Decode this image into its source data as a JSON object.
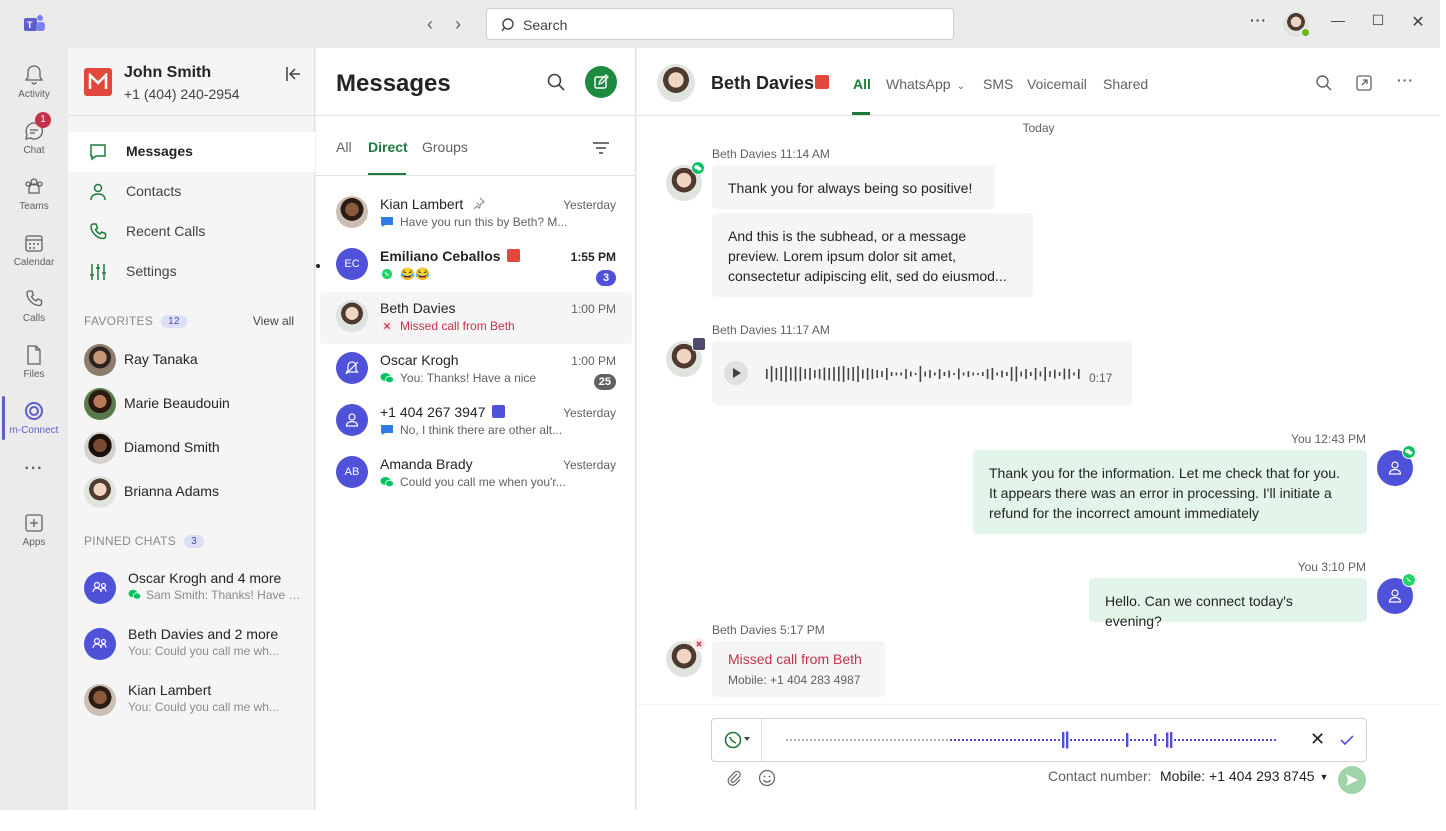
{
  "search": {
    "placeholder": "Search"
  },
  "rail": [
    {
      "label": "Activity"
    },
    {
      "label": "Chat",
      "badge": "1"
    },
    {
      "label": "Teams"
    },
    {
      "label": "Calendar"
    },
    {
      "label": "Calls"
    },
    {
      "label": "Files"
    },
    {
      "label": "m-Connect"
    },
    {
      "label": "Apps"
    }
  ],
  "user": {
    "name": "John Smith",
    "number": "+1 (404) 240-2954"
  },
  "nav": {
    "items": [
      {
        "label": "Messages"
      },
      {
        "label": "Contacts"
      },
      {
        "label": "Recent Calls"
      },
      {
        "label": "Settings"
      }
    ],
    "favorites_label": "FAVORITES",
    "favorites_count": "12",
    "view_all": "View all",
    "favorites": [
      "Ray Tanaka",
      "Marie Beaudouin",
      "Diamond Smith",
      "Brianna Adams"
    ],
    "pinned_label": "PINNED CHATS",
    "pinned_count": "3",
    "pinned": [
      {
        "title": "Oscar Krogh and 4 more",
        "preview": "Sam Smith: Thanks! Have a..."
      },
      {
        "title": "Beth Davies and 2 more",
        "preview": "You: Could you call me wh..."
      },
      {
        "title": "Kian Lambert",
        "preview": "You: Could you call me wh..."
      }
    ]
  },
  "messages": {
    "title": "Messages",
    "tabs": [
      "All",
      "Direct",
      "Groups"
    ],
    "list": [
      {
        "name": "Kian Lambert",
        "preview": "Have you run this by Beth? M...",
        "time": "Yesterday"
      },
      {
        "name": "Emiliano Ceballos",
        "initials": "EC",
        "preview": "😂😂",
        "time": "1:55 PM",
        "badge": "3"
      },
      {
        "name": "Beth Davies",
        "preview": "Missed call from Beth",
        "time": "1:00 PM"
      },
      {
        "name": "Oscar Krogh",
        "preview": "You: Thanks! Have a nice",
        "time": "1:00 PM",
        "badge": "25"
      },
      {
        "name": "+1 404 267 3947",
        "preview": "No, I think there are other alt...",
        "time": "Yesterday"
      },
      {
        "name": "Amanda Brady",
        "initials": "AB",
        "preview": "Could you call me when you'r...",
        "time": "Yesterday"
      }
    ]
  },
  "chat": {
    "name": "Beth Davies",
    "tabs": [
      "All",
      "WhatsApp",
      "SMS",
      "Voicemail",
      "Shared"
    ],
    "day": "Today",
    "m1_meta": "Beth Davies  11:14 AM",
    "m1a": "Thank you for always being so positive!",
    "m1b": "And this is the subhead, or a message preview. Lorem ipsum dolor sit amet, consectetur adipiscing elit, sed do eiusmod...",
    "m2_meta": "Beth Davies  11:17 AM",
    "voice_duration": "0:17",
    "m3_meta": "You  12:43 PM",
    "m3": "Thank you for the information. Let me check that for you. It appears there was an error in processing. I'll initiate a refund for the incorrect amount immediately",
    "m4_meta": "You  3:10 PM",
    "m4": "Hello. Can we connect today's evening?",
    "m5_meta": "Beth Davies  5:17 PM",
    "m5": "Missed call from Beth",
    "m5_sub": "Mobile: +1 404 283 4987",
    "contact_label": "Contact number:",
    "contact_value": "Mobile: +1 404 293 8745"
  },
  "colors": {
    "accent": "#1e7a3c",
    "brand": "#e2473b",
    "rail_active": "#5b5fc7",
    "whatsapp": "#25d366",
    "missed": "#c4314b"
  }
}
